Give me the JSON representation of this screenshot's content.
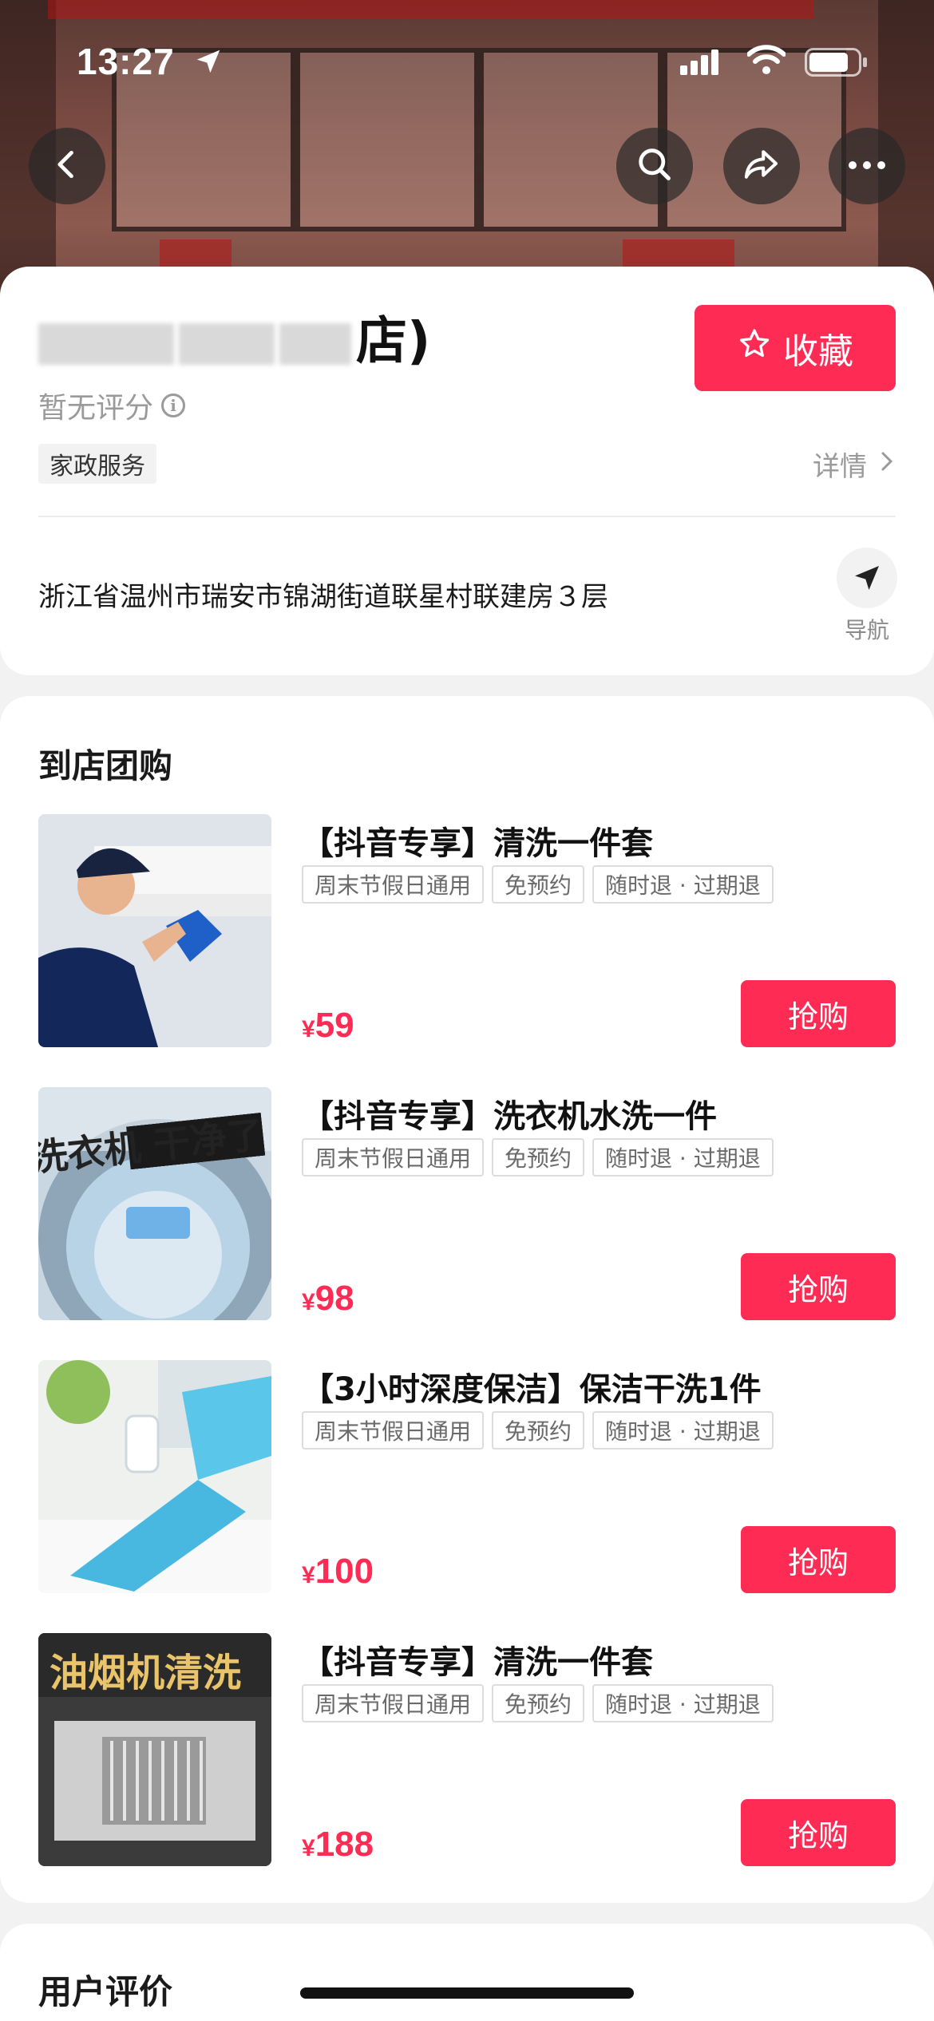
{
  "status_bar": {
    "time": "13:27"
  },
  "store": {
    "name_visible": "店)",
    "rating_text": "暂无评分",
    "favorite_label": "收藏",
    "category": "家政服务",
    "detail_label": "详情",
    "address": "浙江省温州市瑞安市锦湖街道联星村联建房３层",
    "nav_label": "导航"
  },
  "group_buy": {
    "title": "到店团购",
    "deals": [
      {
        "title": "【抖音专享】清洗一件套",
        "tags": [
          "周末节假日通用",
          "免预约",
          "随时退 · 过期退"
        ],
        "currency": "¥",
        "price": "59",
        "buy_label": "抢购"
      },
      {
        "title": "【抖音专享】洗衣机水洗一件",
        "tags": [
          "周末节假日通用",
          "免预约",
          "随时退 · 过期退"
        ],
        "currency": "¥",
        "price": "98",
        "buy_label": "抢购",
        "image_text": "洗衣机 干净了"
      },
      {
        "title": "【3小时深度保洁】保洁干洗1件",
        "tags": [
          "周末节假日通用",
          "免预约",
          "随时退 · 过期退"
        ],
        "currency": "¥",
        "price": "100",
        "buy_label": "抢购"
      },
      {
        "title": "【抖音专享】清洗一件套",
        "tags": [
          "周末节假日通用",
          "免预约",
          "随时退 · 过期退"
        ],
        "currency": "¥",
        "price": "188",
        "buy_label": "抢购",
        "image_text": "油烟机清洗"
      }
    ]
  },
  "reviews": {
    "title": "用户评价"
  },
  "colors": {
    "accent": "#fe2c55"
  },
  "icons": [
    "back-icon",
    "search-icon",
    "share-icon",
    "more-icon",
    "star-icon",
    "info-icon",
    "chevron-right-icon",
    "navigation-icon",
    "location-arrow-icon",
    "signal-icon",
    "wifi-icon",
    "battery-icon"
  ]
}
